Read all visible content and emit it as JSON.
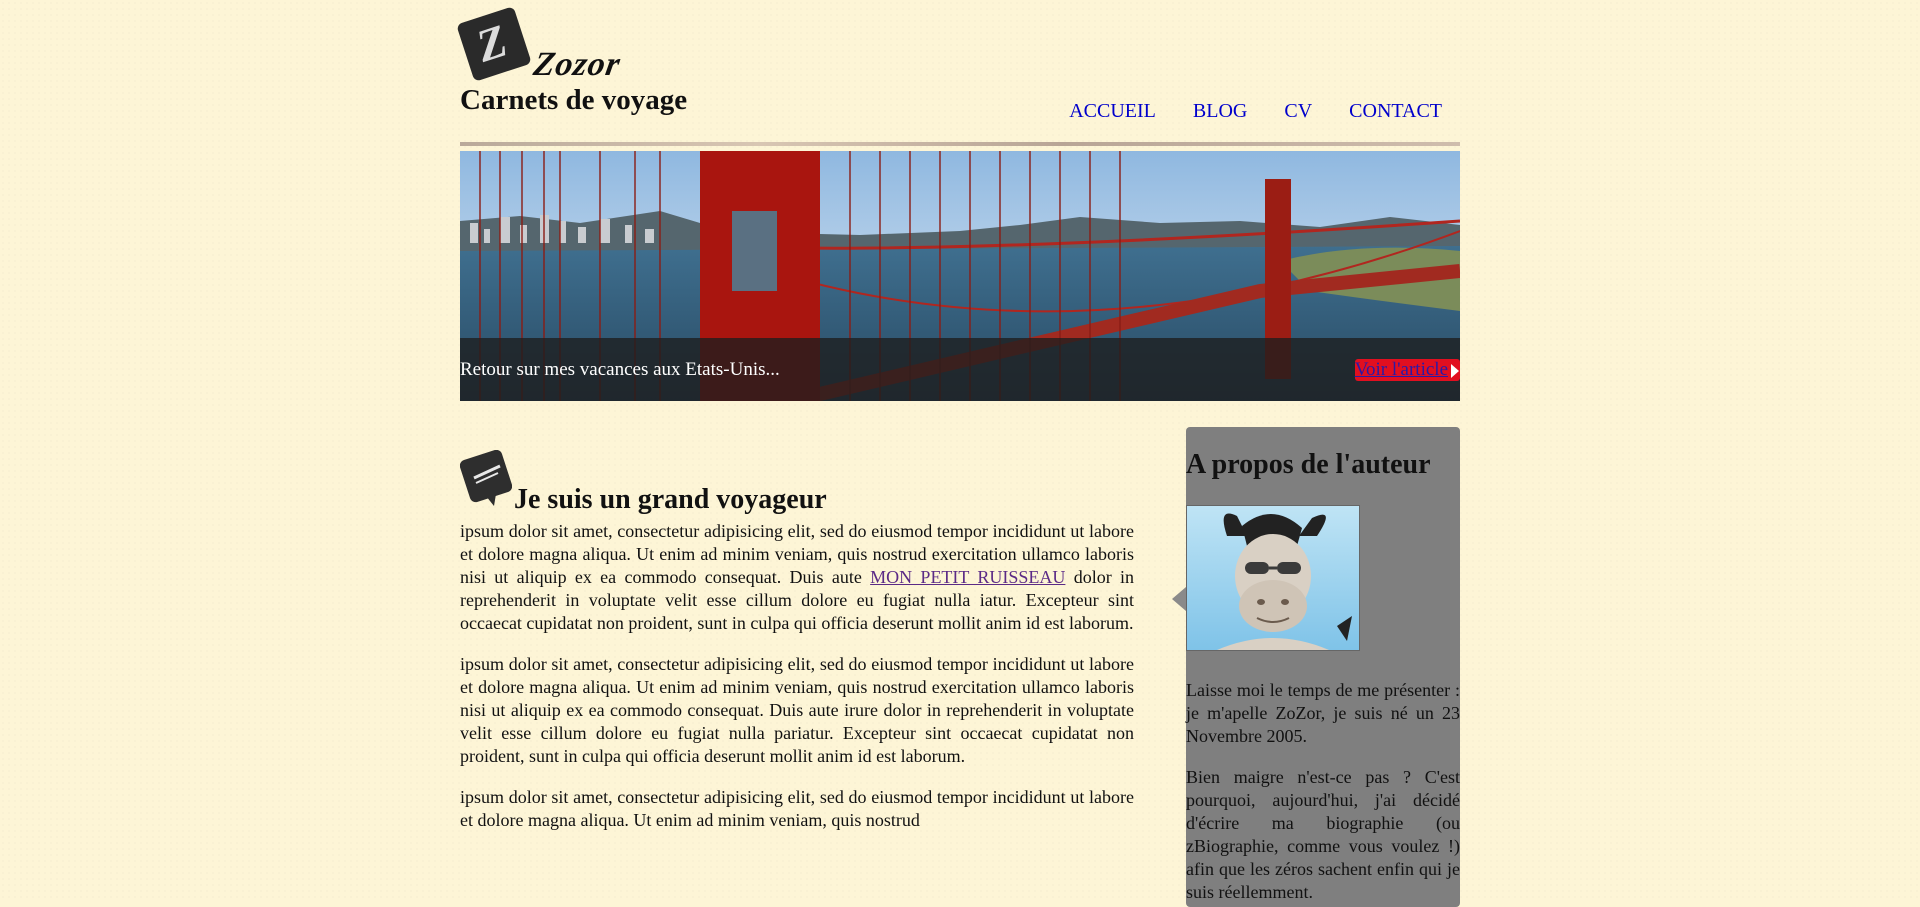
{
  "header": {
    "logo_text": "Zozor",
    "subtitle": "Carnets de voyage"
  },
  "nav": {
    "items": [
      {
        "label": "ACCUEIL"
      },
      {
        "label": "BLOG"
      },
      {
        "label": "CV"
      },
      {
        "label": "CONTACT"
      }
    ],
    "link_color": "#0000cc"
  },
  "banner": {
    "caption": "Retour sur mes vacances aux Etats-Unis...",
    "link_label": "Voir l'article",
    "link_bg_color": "#e10f20"
  },
  "article": {
    "icon": "pen-icon",
    "title": "Je suis un grand voyageur",
    "paragraphs": [
      {
        "before_link": "ipsum dolor sit amet, consectetur adipisicing elit, sed do eiusmod tempor incididunt ut labore et dolore magna aliqua. Ut enim ad minim veniam, quis nostrud exercitation ullamco laboris nisi ut aliquip ex ea commodo consequat. Duis aute ",
        "link": "MON PETIT RUISSEAU",
        "after_link": " dolor in reprehenderit in voluptate velit esse cillum dolore eu fugiat nulla iatur. Excepteur sint occaecat cupidatat non proident, sunt in culpa qui officia deserunt mollit anim id est laborum."
      },
      {
        "text": "ipsum dolor sit amet, consectetur adipisicing elit, sed do eiusmod tempor incididunt ut labore et dolore magna aliqua. Ut enim ad minim veniam, quis nostrud exercitation ullamco laboris nisi ut aliquip ex ea commodo consequat. Duis aute irure dolor in reprehenderit in voluptate velit esse cillum dolore eu fugiat nulla pariatur. Excepteur sint occaecat cupidatat non proident, sunt in culpa qui officia deserunt mollit anim id est laborum."
      },
      {
        "text": "ipsum dolor sit amet, consectetur adipisicing elit, sed do eiusmod tempor incididunt ut labore et dolore magna aliqua. Ut enim ad minim veniam, quis nostrud"
      }
    ]
  },
  "aside": {
    "title": "A propos de l'auteur",
    "paragraphs": [
      "Laisse moi le temps de me présenter : je m'apelle ZoZor, je suis né un 23 Novembre 2005.",
      "Bien maigre n'est-ce pas ? C'est pourquoi, aujourd'hui, j'ai décidé d'écrire ma biographie (ou zBiographie, comme vous voulez !) afin que les zéros sachent enfin qui je suis réellemment."
    ],
    "bg_color": "#7f7f7f"
  },
  "page_bg_color": "#fdf5d6"
}
